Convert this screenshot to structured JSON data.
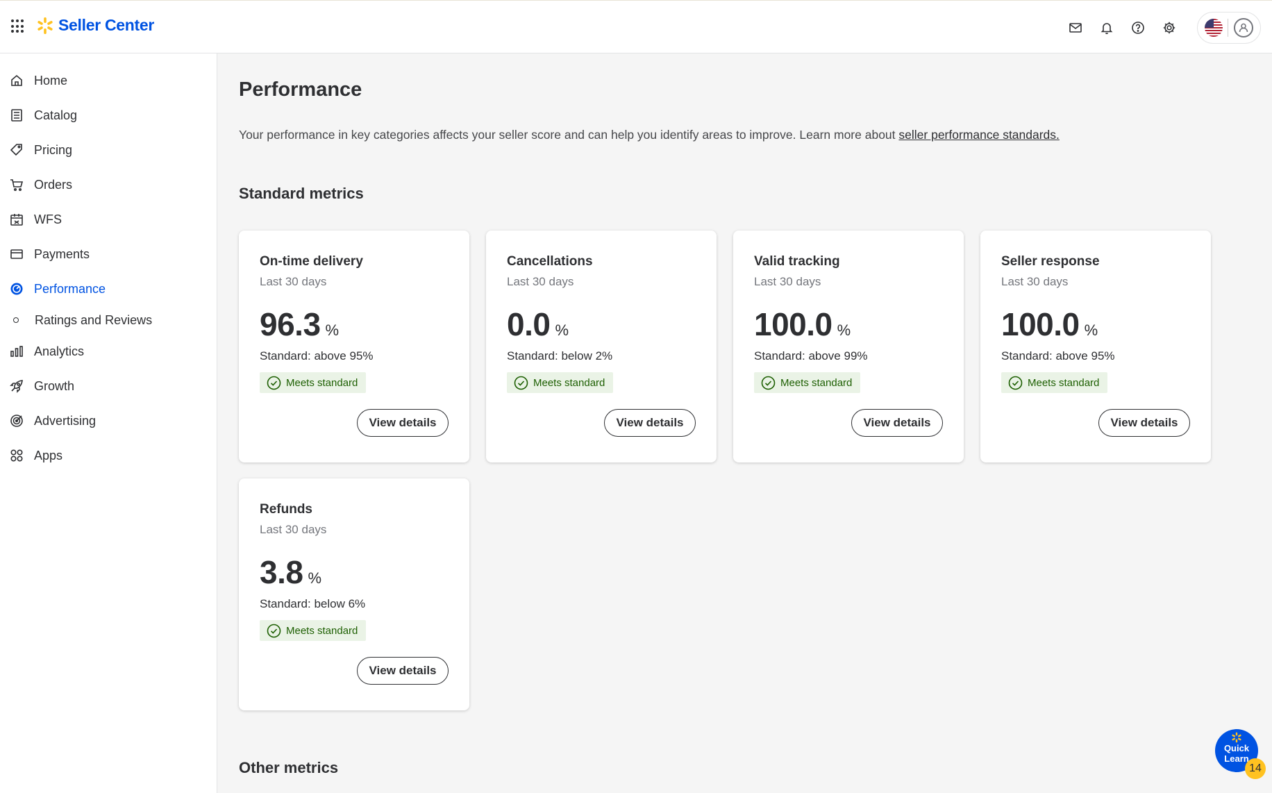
{
  "header": {
    "app_title": "Seller Center",
    "icons": [
      "apps-grid-icon",
      "spark-logo-icon",
      "mail-icon",
      "bell-icon",
      "help-icon",
      "gear-icon",
      "us-flag-icon",
      "user-avatar-icon"
    ]
  },
  "sidebar": {
    "items": [
      {
        "label": "Home",
        "icon": "home-icon"
      },
      {
        "label": "Catalog",
        "icon": "catalog-icon"
      },
      {
        "label": "Pricing",
        "icon": "tag-icon"
      },
      {
        "label": "Orders",
        "icon": "cart-icon"
      },
      {
        "label": "WFS",
        "icon": "warehouse-icon"
      },
      {
        "label": "Payments",
        "icon": "card-icon"
      },
      {
        "label": "Performance",
        "icon": "gauge-icon",
        "active": true
      },
      {
        "label": "Analytics",
        "icon": "bar-chart-icon"
      },
      {
        "label": "Growth",
        "icon": "rocket-icon"
      },
      {
        "label": "Advertising",
        "icon": "target-icon"
      },
      {
        "label": "Apps",
        "icon": "apps-icon"
      }
    ],
    "sub_item": {
      "label": "Ratings and Reviews"
    }
  },
  "main": {
    "title": "Performance",
    "intro": "Your performance in key categories affects your seller score and can help you identify areas to improve. Learn more about",
    "intro_link": "seller performance standards.",
    "standard_section": "Standard metrics",
    "other_section": "Other metrics",
    "cards": [
      {
        "title": "On-time delivery",
        "period": "Last 30 days",
        "value": "96.3",
        "unit": "%",
        "standard": "Standard: above 95%",
        "status": "Meets standard",
        "button": "View details"
      },
      {
        "title": "Cancellations",
        "period": "Last 30 days",
        "value": "0.0",
        "unit": "%",
        "standard": "Standard: below 2%",
        "status": "Meets standard",
        "button": "View details"
      },
      {
        "title": "Valid tracking",
        "period": "Last 30 days",
        "value": "100.0",
        "unit": "%",
        "standard": "Standard: above 99%",
        "status": "Meets standard",
        "button": "View details"
      },
      {
        "title": "Seller response",
        "period": "Last 30 days",
        "value": "100.0",
        "unit": "%",
        "standard": "Standard: above 95%",
        "status": "Meets standard",
        "button": "View details"
      },
      {
        "title": "Refunds",
        "period": "Last 30 days",
        "value": "3.8",
        "unit": "%",
        "standard": "Standard: below 6%",
        "status": "Meets standard",
        "button": "View details"
      }
    ]
  },
  "quick_learn": {
    "label_line1": "Quick",
    "label_line2": "Learn",
    "badge": "14"
  },
  "colors": {
    "accent": "#0053e2",
    "spark": "#ffc220",
    "success_bg": "#eaf3e6",
    "success_text": "#1d5f02"
  }
}
